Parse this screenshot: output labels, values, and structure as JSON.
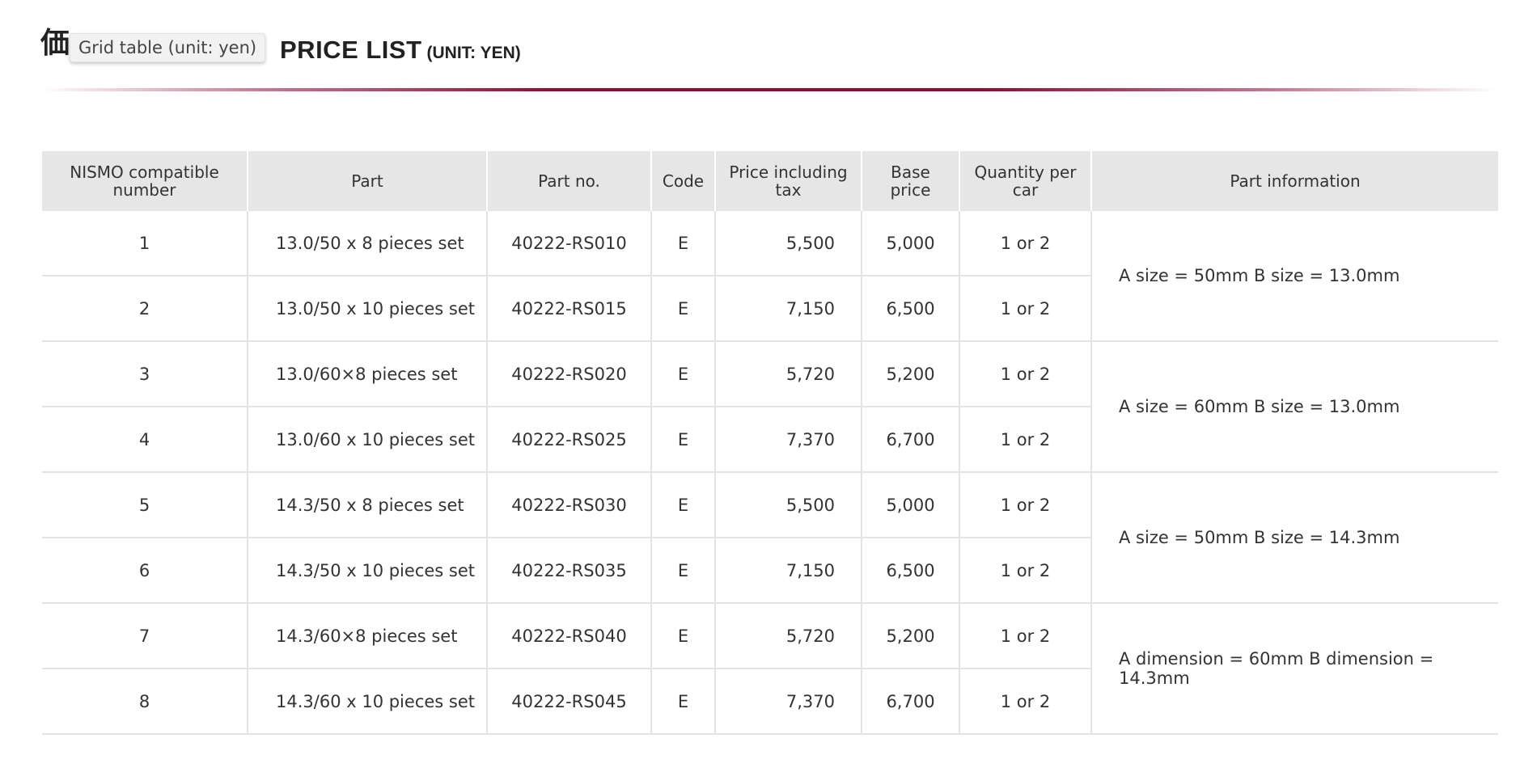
{
  "header": {
    "kanji": "価",
    "tooltip": "Grid table (unit: yen)",
    "title": "PRICE LIST",
    "title_unit": "(UNIT: YEN)"
  },
  "colors": {
    "accent": "#8e0f33",
    "header_bg": "#e6e6e6",
    "border": "#e3e3e3"
  },
  "table": {
    "columns": [
      "NISMO compatible number",
      "Part",
      "Part no.",
      "Code",
      "Price including tax",
      "Base price",
      "Quantity per car",
      "Part information"
    ],
    "rows": [
      {
        "num": "1",
        "part": "13.0/50 x 8 pieces set",
        "partno": "40222-RS010",
        "code": "E",
        "price_tax": "5,500",
        "base": "5,000",
        "qty": "1 or 2"
      },
      {
        "num": "2",
        "part": "13.0/50 x 10 pieces set",
        "partno": "40222-RS015",
        "code": "E",
        "price_tax": "7,150",
        "base": "6,500",
        "qty": "1 or 2"
      },
      {
        "num": "3",
        "part": "13.0/60×8 pieces set",
        "partno": "40222-RS020",
        "code": "E",
        "price_tax": "5,720",
        "base": "5,200",
        "qty": "1 or 2"
      },
      {
        "num": "4",
        "part": "13.0/60 x 10 pieces set",
        "partno": "40222-RS025",
        "code": "E",
        "price_tax": "7,370",
        "base": "6,700",
        "qty": "1 or 2"
      },
      {
        "num": "5",
        "part": "14.3/50 x 8 pieces set",
        "partno": "40222-RS030",
        "code": "E",
        "price_tax": "5,500",
        "base": "5,000",
        "qty": "1 or 2"
      },
      {
        "num": "6",
        "part": "14.3/50 x 10 pieces set",
        "partno": "40222-RS035",
        "code": "E",
        "price_tax": "7,150",
        "base": "6,500",
        "qty": "1 or 2"
      },
      {
        "num": "7",
        "part": "14.3/60×8 pieces set",
        "partno": "40222-RS040",
        "code": "E",
        "price_tax": "5,720",
        "base": "5,200",
        "qty": "1 or 2"
      },
      {
        "num": "8",
        "part": "14.3/60 x 10 pieces set",
        "partno": "40222-RS045",
        "code": "E",
        "price_tax": "7,370",
        "base": "6,700",
        "qty": "1 or 2"
      }
    ],
    "info": [
      "A size = 50mm B size = 13.0mm",
      "A size = 60mm B size = 13.0mm",
      "A size = 50mm B size = 14.3mm",
      "A dimension = 60mm B dimension = 14.3mm"
    ]
  }
}
